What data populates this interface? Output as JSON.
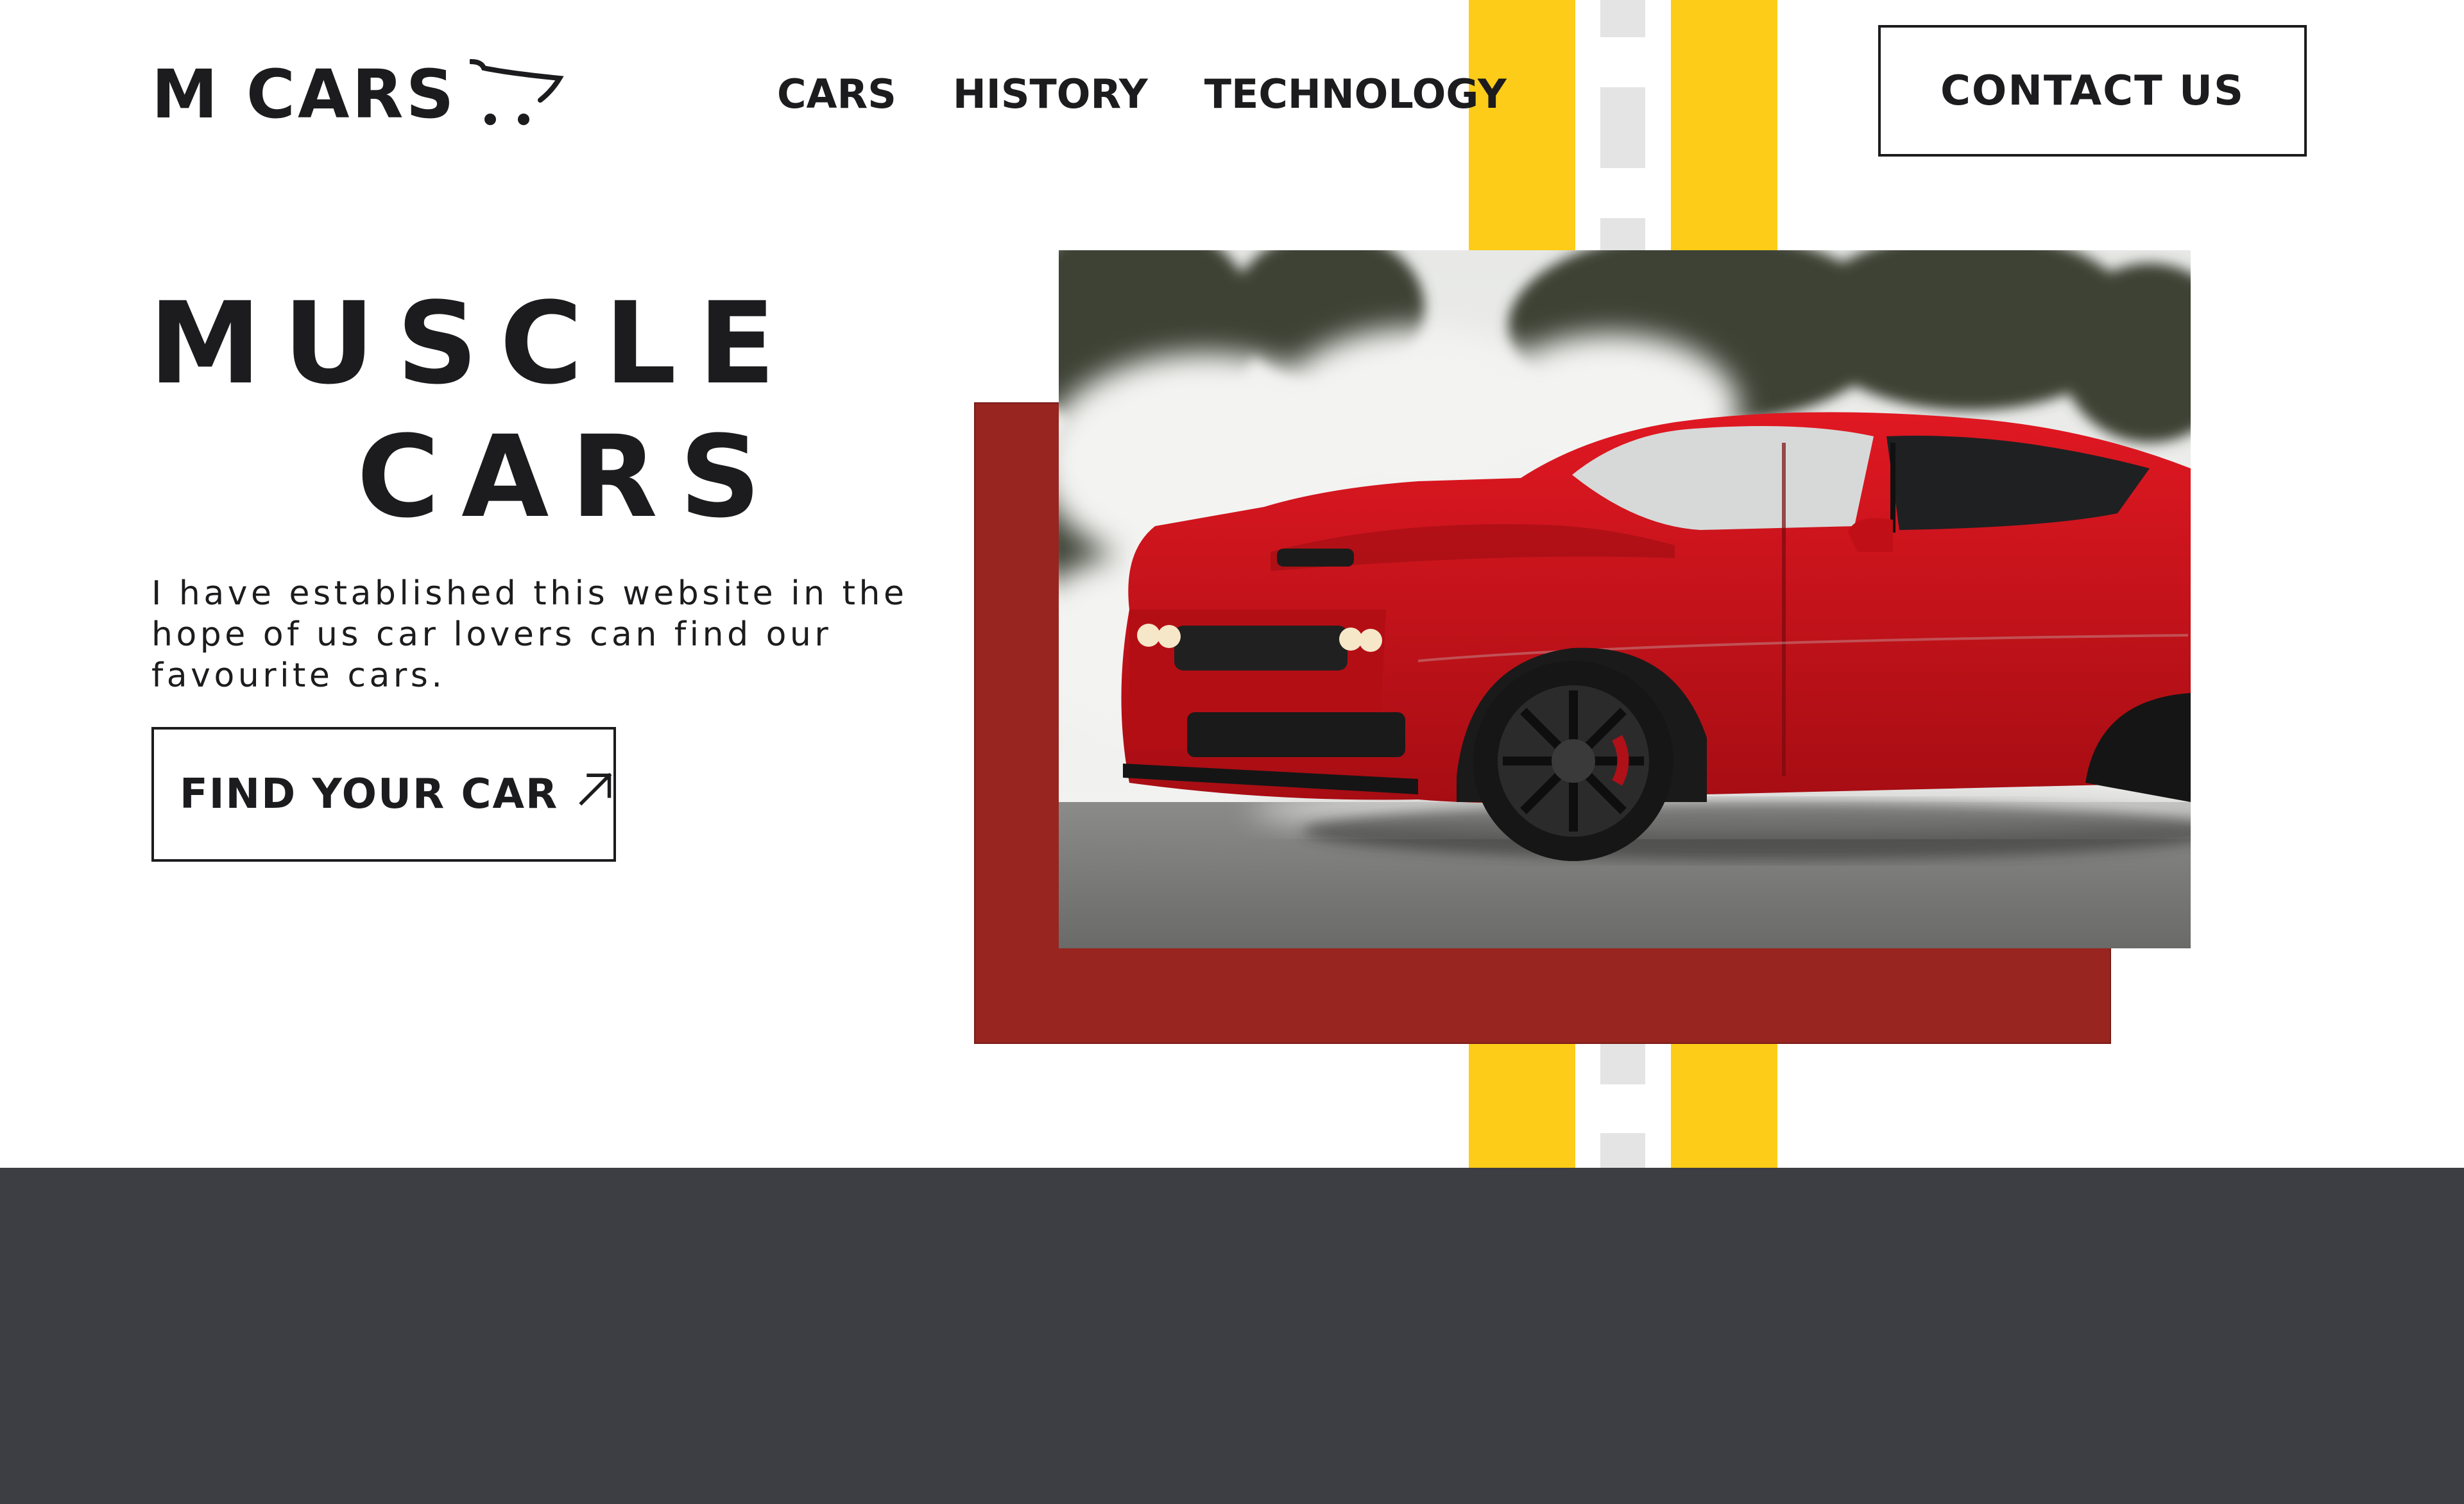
{
  "brand": {
    "name": "M CARS",
    "icon": "shopping-cart-icon"
  },
  "nav": {
    "items": [
      "CARS",
      "HISTORY",
      "TECHNOLOGY"
    ]
  },
  "header": {
    "contact_label": "CONTACT US"
  },
  "hero": {
    "title_line_1": "MUSCLE",
    "title_line_2": "CARS",
    "intro_line_1": "I have established this website in the",
    "intro_line_2": "hope of us car lovers can find our",
    "intro_line_3": "favourite cars.",
    "cta_label": "FIND YOUR CAR",
    "cta_icon": "arrow-up-right-icon",
    "image_alt": "red muscle car drifting with tire smoke"
  },
  "colors": {
    "text": "#1c1c1e",
    "accent_yellow": "#fdcc18",
    "accent_red": "#98251f",
    "car_red": "#d3111a",
    "footer": "#3d3e43",
    "dash": "#e4e4e4"
  }
}
